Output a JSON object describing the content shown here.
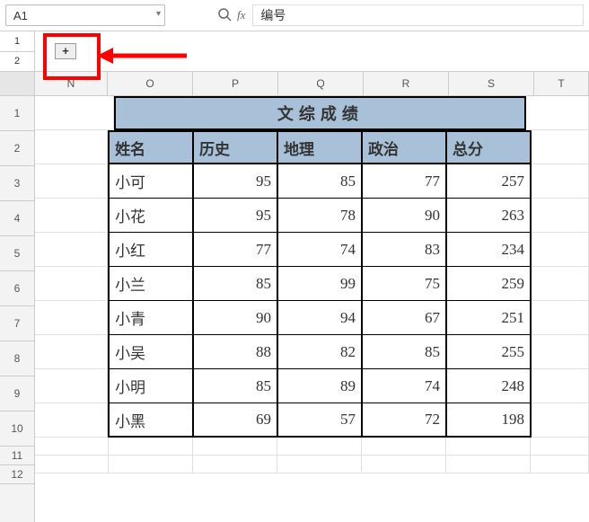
{
  "name_box": "A1",
  "formula_value": "编号",
  "outline_levels": [
    "1",
    "2"
  ],
  "plus_label": "+",
  "columns": [
    "N",
    "O",
    "P",
    "Q",
    "R",
    "S",
    "T"
  ],
  "rows": [
    "1",
    "2",
    "3",
    "4",
    "5",
    "6",
    "7",
    "8",
    "9",
    "10",
    "11",
    "12"
  ],
  "data": {
    "title": "文综成绩",
    "headers": [
      "姓名",
      "历史",
      "地理",
      "政治",
      "总分"
    ],
    "rows": [
      {
        "name": "小可",
        "scores": [
          95,
          85,
          77,
          257
        ]
      },
      {
        "name": "小花",
        "scores": [
          95,
          78,
          90,
          263
        ]
      },
      {
        "name": "小红",
        "scores": [
          77,
          74,
          83,
          234
        ]
      },
      {
        "name": "小兰",
        "scores": [
          85,
          99,
          75,
          259
        ]
      },
      {
        "name": "小青",
        "scores": [
          90,
          94,
          67,
          251
        ]
      },
      {
        "name": "小吴",
        "scores": [
          88,
          82,
          85,
          255
        ]
      },
      {
        "name": "小明",
        "scores": [
          85,
          89,
          74,
          248
        ]
      },
      {
        "name": "小黑",
        "scores": [
          69,
          57,
          72,
          198
        ]
      }
    ]
  }
}
